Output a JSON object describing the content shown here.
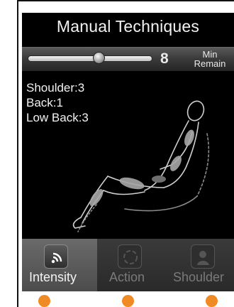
{
  "title": "Manual Techniques",
  "timer": {
    "minutes": "8",
    "unit_line1": "Min",
    "unit_line2": "Remain",
    "slider_fraction": 0.57
  },
  "levels": [
    {
      "text": "Shoulder:3"
    },
    {
      "text": "Back:1"
    },
    {
      "text": "Low Back:3"
    }
  ],
  "tabs": [
    {
      "label": "Intensity",
      "icon": "intensity-icon",
      "active": true
    },
    {
      "label": "Action",
      "icon": "action-icon",
      "active": false
    },
    {
      "label": "Shoulder",
      "icon": "shoulder-icon",
      "active": false
    }
  ],
  "colors": {
    "background": "#000000",
    "text": "#f2f2f2",
    "inactive_tab_text": "#7a7a7a",
    "indicator_dot": "#f08a24",
    "body_highlight": "#a8a8a8"
  }
}
